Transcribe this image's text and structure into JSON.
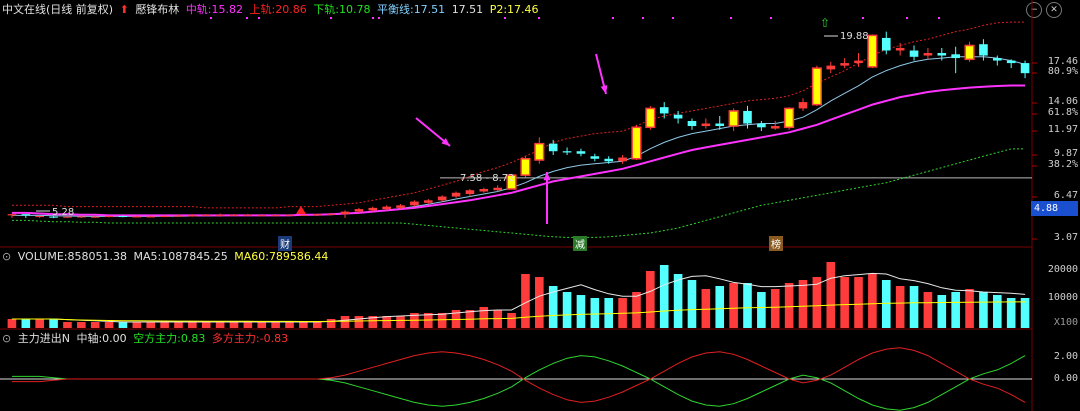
{
  "header": {
    "title": "中文在线(日线 前复权)",
    "indicator_name": "懕锋布林",
    "mid_label": "中轨:",
    "mid_value": "15.82",
    "upper_label": "上轨:",
    "upper_value": "20.86",
    "lower_label": "下轨:",
    "lower_value": "10.78",
    "balance_label": "平衡线:",
    "balance_value1": "17.51",
    "balance_value2": "17.51",
    "p2_label": "P2:",
    "p2_value": "17.46"
  },
  "main_axis": {
    "labels": [
      "17.46",
      "80.9%",
      "14.06",
      "61.8%",
      "11.97",
      "9.87",
      "38.2%",
      "6.47",
      "4.88",
      "3.07"
    ]
  },
  "annotations": {
    "low_label": "5.28",
    "high_label": "19.88",
    "range_label": "7.58 - 8.72",
    "badges": [
      "财",
      "减",
      "榜"
    ]
  },
  "volume": {
    "name": "VOLUME:",
    "value": "858051.38",
    "ma5_label": "MA5:",
    "ma5_value": "1087845.25",
    "ma60_label": "MA60:",
    "ma60_value": "789586.44",
    "axis": [
      "20000",
      "10000"
    ],
    "unit": "X100"
  },
  "indicator2": {
    "name": "主力进出N",
    "axis_label": "中轴:",
    "axis_value": "0.00",
    "short_label": "空方主力:",
    "short_value": "0.83",
    "long_label": "多方主力:",
    "long_value": "-0.83",
    "axis": [
      "2.00",
      "0.00"
    ]
  },
  "colors": {
    "up": "#ff3c3c",
    "down": "#54ffff",
    "yellow": "#ffff00",
    "magenta": "#ff33ff",
    "white": "#d8d8d8",
    "green": "#2fd52f",
    "red": "#e02020",
    "grid": "#7a0000"
  },
  "chart_data": {
    "type": "candlestick",
    "ylim": [
      3.07,
      21.5
    ],
    "candles": [
      [
        5.5,
        5.6,
        5.3,
        5.6
      ],
      [
        5.6,
        5.5,
        5.3,
        5.6
      ],
      [
        5.4,
        5.45,
        5.3,
        5.5
      ],
      [
        5.4,
        5.38,
        5.28,
        5.45
      ],
      [
        5.35,
        5.4,
        5.3,
        5.45
      ],
      [
        5.4,
        5.42,
        5.3,
        5.5
      ],
      [
        5.4,
        5.4,
        5.3,
        5.5
      ],
      [
        5.4,
        5.45,
        5.35,
        5.5
      ],
      [
        5.45,
        5.4,
        5.35,
        5.5
      ],
      [
        5.4,
        5.42,
        5.35,
        5.5
      ],
      [
        5.4,
        5.42,
        5.35,
        5.5
      ],
      [
        5.42,
        5.45,
        5.4,
        5.5
      ],
      [
        5.45,
        5.48,
        5.4,
        5.55
      ],
      [
        5.48,
        5.5,
        5.4,
        5.6
      ],
      [
        5.5,
        5.55,
        5.45,
        5.6
      ],
      [
        5.5,
        5.55,
        5.4,
        5.65
      ],
      [
        5.5,
        5.55,
        5.45,
        5.6
      ],
      [
        5.55,
        5.55,
        5.45,
        5.62
      ],
      [
        5.5,
        5.52,
        5.45,
        5.6
      ],
      [
        5.5,
        5.52,
        5.45,
        5.6
      ],
      [
        5.5,
        5.55,
        5.45,
        5.6
      ],
      [
        5.5,
        5.55,
        5.45,
        5.6
      ],
      [
        5.5,
        5.6,
        5.45,
        5.65
      ],
      [
        5.55,
        5.62,
        5.5,
        5.7
      ],
      [
        5.6,
        5.8,
        5.3,
        5.9
      ],
      [
        5.8,
        6.0,
        5.7,
        6.1
      ],
      [
        5.9,
        6.1,
        5.8,
        6.2
      ],
      [
        6.0,
        6.2,
        5.9,
        6.3
      ],
      [
        6.1,
        6.3,
        6.0,
        6.4
      ],
      [
        6.3,
        6.6,
        6.2,
        6.7
      ],
      [
        6.5,
        6.7,
        6.4,
        6.8
      ],
      [
        6.7,
        7.0,
        6.6,
        7.1
      ],
      [
        7.0,
        7.3,
        6.9,
        7.4
      ],
      [
        7.2,
        7.5,
        7.0,
        7.6
      ],
      [
        7.4,
        7.6,
        7.3,
        7.7
      ],
      [
        7.5,
        7.7,
        7.4,
        7.9
      ],
      [
        7.6,
        8.7,
        7.58,
        8.8
      ],
      [
        8.7,
        10.0,
        8.5,
        10.2
      ],
      [
        9.9,
        11.2,
        9.6,
        11.7
      ],
      [
        11.2,
        10.6,
        10.3,
        11.5
      ],
      [
        10.6,
        10.5,
        10.3,
        10.9
      ],
      [
        10.6,
        10.4,
        10.2,
        10.8
      ],
      [
        10.2,
        10.0,
        9.8,
        10.4
      ],
      [
        10.0,
        9.8,
        9.6,
        10.2
      ],
      [
        9.8,
        10.1,
        9.6,
        10.3
      ],
      [
        10.0,
        12.5,
        9.9,
        12.7
      ],
      [
        12.5,
        14.0,
        12.3,
        14.2
      ],
      [
        14.1,
        13.6,
        13.2,
        14.5
      ],
      [
        13.5,
        13.2,
        12.8,
        13.8
      ],
      [
        13.0,
        12.6,
        12.3,
        13.2
      ],
      [
        12.6,
        12.8,
        12.4,
        13.2
      ],
      [
        12.8,
        12.6,
        12.3,
        13.4
      ],
      [
        12.6,
        13.8,
        12.2,
        14.0
      ],
      [
        13.8,
        12.8,
        12.4,
        14.2
      ],
      [
        12.8,
        12.5,
        12.2,
        13.0
      ],
      [
        12.4,
        12.6,
        12.3,
        13.0
      ],
      [
        12.5,
        14.0,
        12.3,
        14.1
      ],
      [
        14.0,
        14.5,
        13.8,
        14.8
      ],
      [
        14.3,
        17.2,
        14.2,
        17.4
      ],
      [
        17.1,
        17.4,
        16.8,
        17.7
      ],
      [
        17.4,
        17.6,
        17.2,
        18.0
      ],
      [
        17.6,
        17.8,
        17.3,
        18.4
      ],
      [
        17.3,
        19.8,
        17.2,
        19.88
      ],
      [
        19.6,
        18.6,
        18.3,
        20.1
      ],
      [
        18.6,
        18.8,
        18.2,
        19.2
      ],
      [
        18.6,
        18.1,
        17.8,
        19.0
      ],
      [
        18.2,
        18.4,
        17.9,
        18.8
      ],
      [
        18.4,
        18.2,
        17.8,
        18.8
      ],
      [
        18.3,
        18.0,
        16.8,
        18.9
      ],
      [
        17.9,
        19.0,
        17.7,
        19.3
      ],
      [
        19.1,
        18.2,
        17.8,
        19.5
      ],
      [
        18.0,
        17.8,
        17.4,
        18.2
      ],
      [
        17.8,
        17.6,
        17.2,
        17.9
      ],
      [
        17.6,
        16.8,
        16.4,
        17.8
      ]
    ],
    "volume": [
      3,
      3,
      3,
      3,
      2,
      2,
      2,
      2,
      2,
      2,
      2,
      2,
      2,
      2,
      2,
      2,
      2,
      2,
      2,
      2,
      2,
      2,
      2,
      3,
      4,
      4,
      4,
      4,
      4,
      5,
      5,
      5,
      6,
      6,
      7,
      6,
      5,
      18,
      17,
      14,
      12,
      11,
      10,
      10,
      10,
      12,
      19,
      21,
      18,
      16,
      13,
      14,
      15,
      15,
      12,
      13,
      15,
      16,
      17,
      22,
      17,
      17,
      18,
      16,
      14,
      14,
      12,
      11,
      12,
      13,
      12,
      11,
      10,
      10
    ],
    "upper_band": [
      6.3,
      6.3,
      6.3,
      6.3,
      6.2,
      6.2,
      6.2,
      6.2,
      6.2,
      6.2,
      6.2,
      6.2,
      6.2,
      6.2,
      6.1,
      6.1,
      6.1,
      6.1,
      6.1,
      6.1,
      6.2,
      6.2,
      6.2,
      6.3,
      6.4,
      6.5,
      6.7,
      6.9,
      7.1,
      7.3,
      7.6,
      7.9,
      8.2,
      8.6,
      9.0,
      9.3,
      9.7,
      10.2,
      10.7,
      11.3,
      11.6,
      11.8,
      12.0,
      12.1,
      12.2,
      12.6,
      13.1,
      13.4,
      13.6,
      13.8,
      14.0,
      14.2,
      14.4,
      14.6,
      14.7,
      14.8,
      15.0,
      15.4,
      16.0,
      16.5,
      17.0,
      17.6,
      18.2,
      18.7,
      19.0,
      19.3,
      19.5,
      19.8,
      20.1,
      20.3,
      20.6,
      20.8,
      20.86,
      20.86
    ],
    "middle_band": [
      5.7,
      5.7,
      5.65,
      5.6,
      5.6,
      5.55,
      5.55,
      5.5,
      5.5,
      5.5,
      5.5,
      5.5,
      5.5,
      5.5,
      5.5,
      5.5,
      5.5,
      5.5,
      5.5,
      5.5,
      5.5,
      5.55,
      5.55,
      5.6,
      5.65,
      5.7,
      5.8,
      5.9,
      6.0,
      6.1,
      6.25,
      6.4,
      6.55,
      6.7,
      6.9,
      7.1,
      7.3,
      7.6,
      7.9,
      8.2,
      8.4,
      8.6,
      8.8,
      9.0,
      9.2,
      9.5,
      9.8,
      10.1,
      10.4,
      10.7,
      10.9,
      11.1,
      11.3,
      11.5,
      11.7,
      11.9,
      12.1,
      12.4,
      12.7,
      13.1,
      13.5,
      13.9,
      14.3,
      14.6,
      14.9,
      15.1,
      15.3,
      15.45,
      15.55,
      15.65,
      15.72,
      15.78,
      15.82,
      15.82
    ],
    "lower_band": [
      5.1,
      5.1,
      5.05,
      5.0,
      5.0,
      4.95,
      4.95,
      4.9,
      4.9,
      4.9,
      4.9,
      4.9,
      4.9,
      4.9,
      4.9,
      4.9,
      4.9,
      4.9,
      4.9,
      4.9,
      4.9,
      4.9,
      4.9,
      4.9,
      4.9,
      4.9,
      4.9,
      4.9,
      4.9,
      4.8,
      4.7,
      4.6,
      4.5,
      4.4,
      4.3,
      4.2,
      4.1,
      4.0,
      3.9,
      3.8,
      3.75,
      3.75,
      3.75,
      3.8,
      3.9,
      4.0,
      4.1,
      4.3,
      4.5,
      4.8,
      5.1,
      5.4,
      5.7,
      6.0,
      6.3,
      6.5,
      6.7,
      6.9,
      7.1,
      7.3,
      7.5,
      7.7,
      7.9,
      8.1,
      8.4,
      8.7,
      9.0,
      9.3,
      9.6,
      9.9,
      10.2,
      10.5,
      10.78,
      10.78
    ],
    "ma_line": [
      5.5,
      5.5,
      5.5,
      5.48,
      5.45,
      5.43,
      5.42,
      5.42,
      5.42,
      5.42,
      5.42,
      5.43,
      5.44,
      5.45,
      5.46,
      5.48,
      5.5,
      5.5,
      5.5,
      5.5,
      5.5,
      5.52,
      5.54,
      5.57,
      5.62,
      5.7,
      5.8,
      5.92,
      6.05,
      6.2,
      6.38,
      6.58,
      6.8,
      7.0,
      7.2,
      7.4,
      7.7,
      8.1,
      8.6,
      9.0,
      9.3,
      9.5,
      9.6,
      9.7,
      9.8,
      10.2,
      10.8,
      11.3,
      11.7,
      12.0,
      12.2,
      12.4,
      12.6,
      12.7,
      12.8,
      12.8,
      13.0,
      13.3,
      13.9,
      14.6,
      15.2,
      15.8,
      16.5,
      17.0,
      17.4,
      17.7,
      17.9,
      18.0,
      18.1,
      18.1,
      18.1,
      18.0,
      17.8,
      17.5
    ],
    "balance_line": 8.4,
    "short_main": [
      0.2,
      0.2,
      0.2,
      0.1,
      0.0,
      0.0,
      0,
      0,
      0,
      0,
      0,
      0,
      0,
      0,
      0,
      0,
      0,
      0,
      0,
      0,
      0,
      0,
      0,
      -0.1,
      -0.3,
      -0.6,
      -0.9,
      -1.2,
      -1.5,
      -1.8,
      -2.0,
      -2.1,
      -2.0,
      -1.8,
      -1.5,
      -1.1,
      -0.6,
      0.1,
      0.7,
      1.2,
      1.6,
      1.8,
      1.7,
      1.4,
      1.0,
      0.5,
      0.0,
      -0.6,
      -1.2,
      -1.7,
      -2.0,
      -2.1,
      -1.9,
      -1.5,
      -1.0,
      -0.5,
      0.0,
      0.3,
      0.1,
      -0.3,
      -0.9,
      -1.5,
      -2.0,
      -2.3,
      -2.4,
      -2.2,
      -1.8,
      -1.2,
      -0.6,
      0.0,
      0.4,
      0.7,
      1.2,
      1.8
    ]
  }
}
